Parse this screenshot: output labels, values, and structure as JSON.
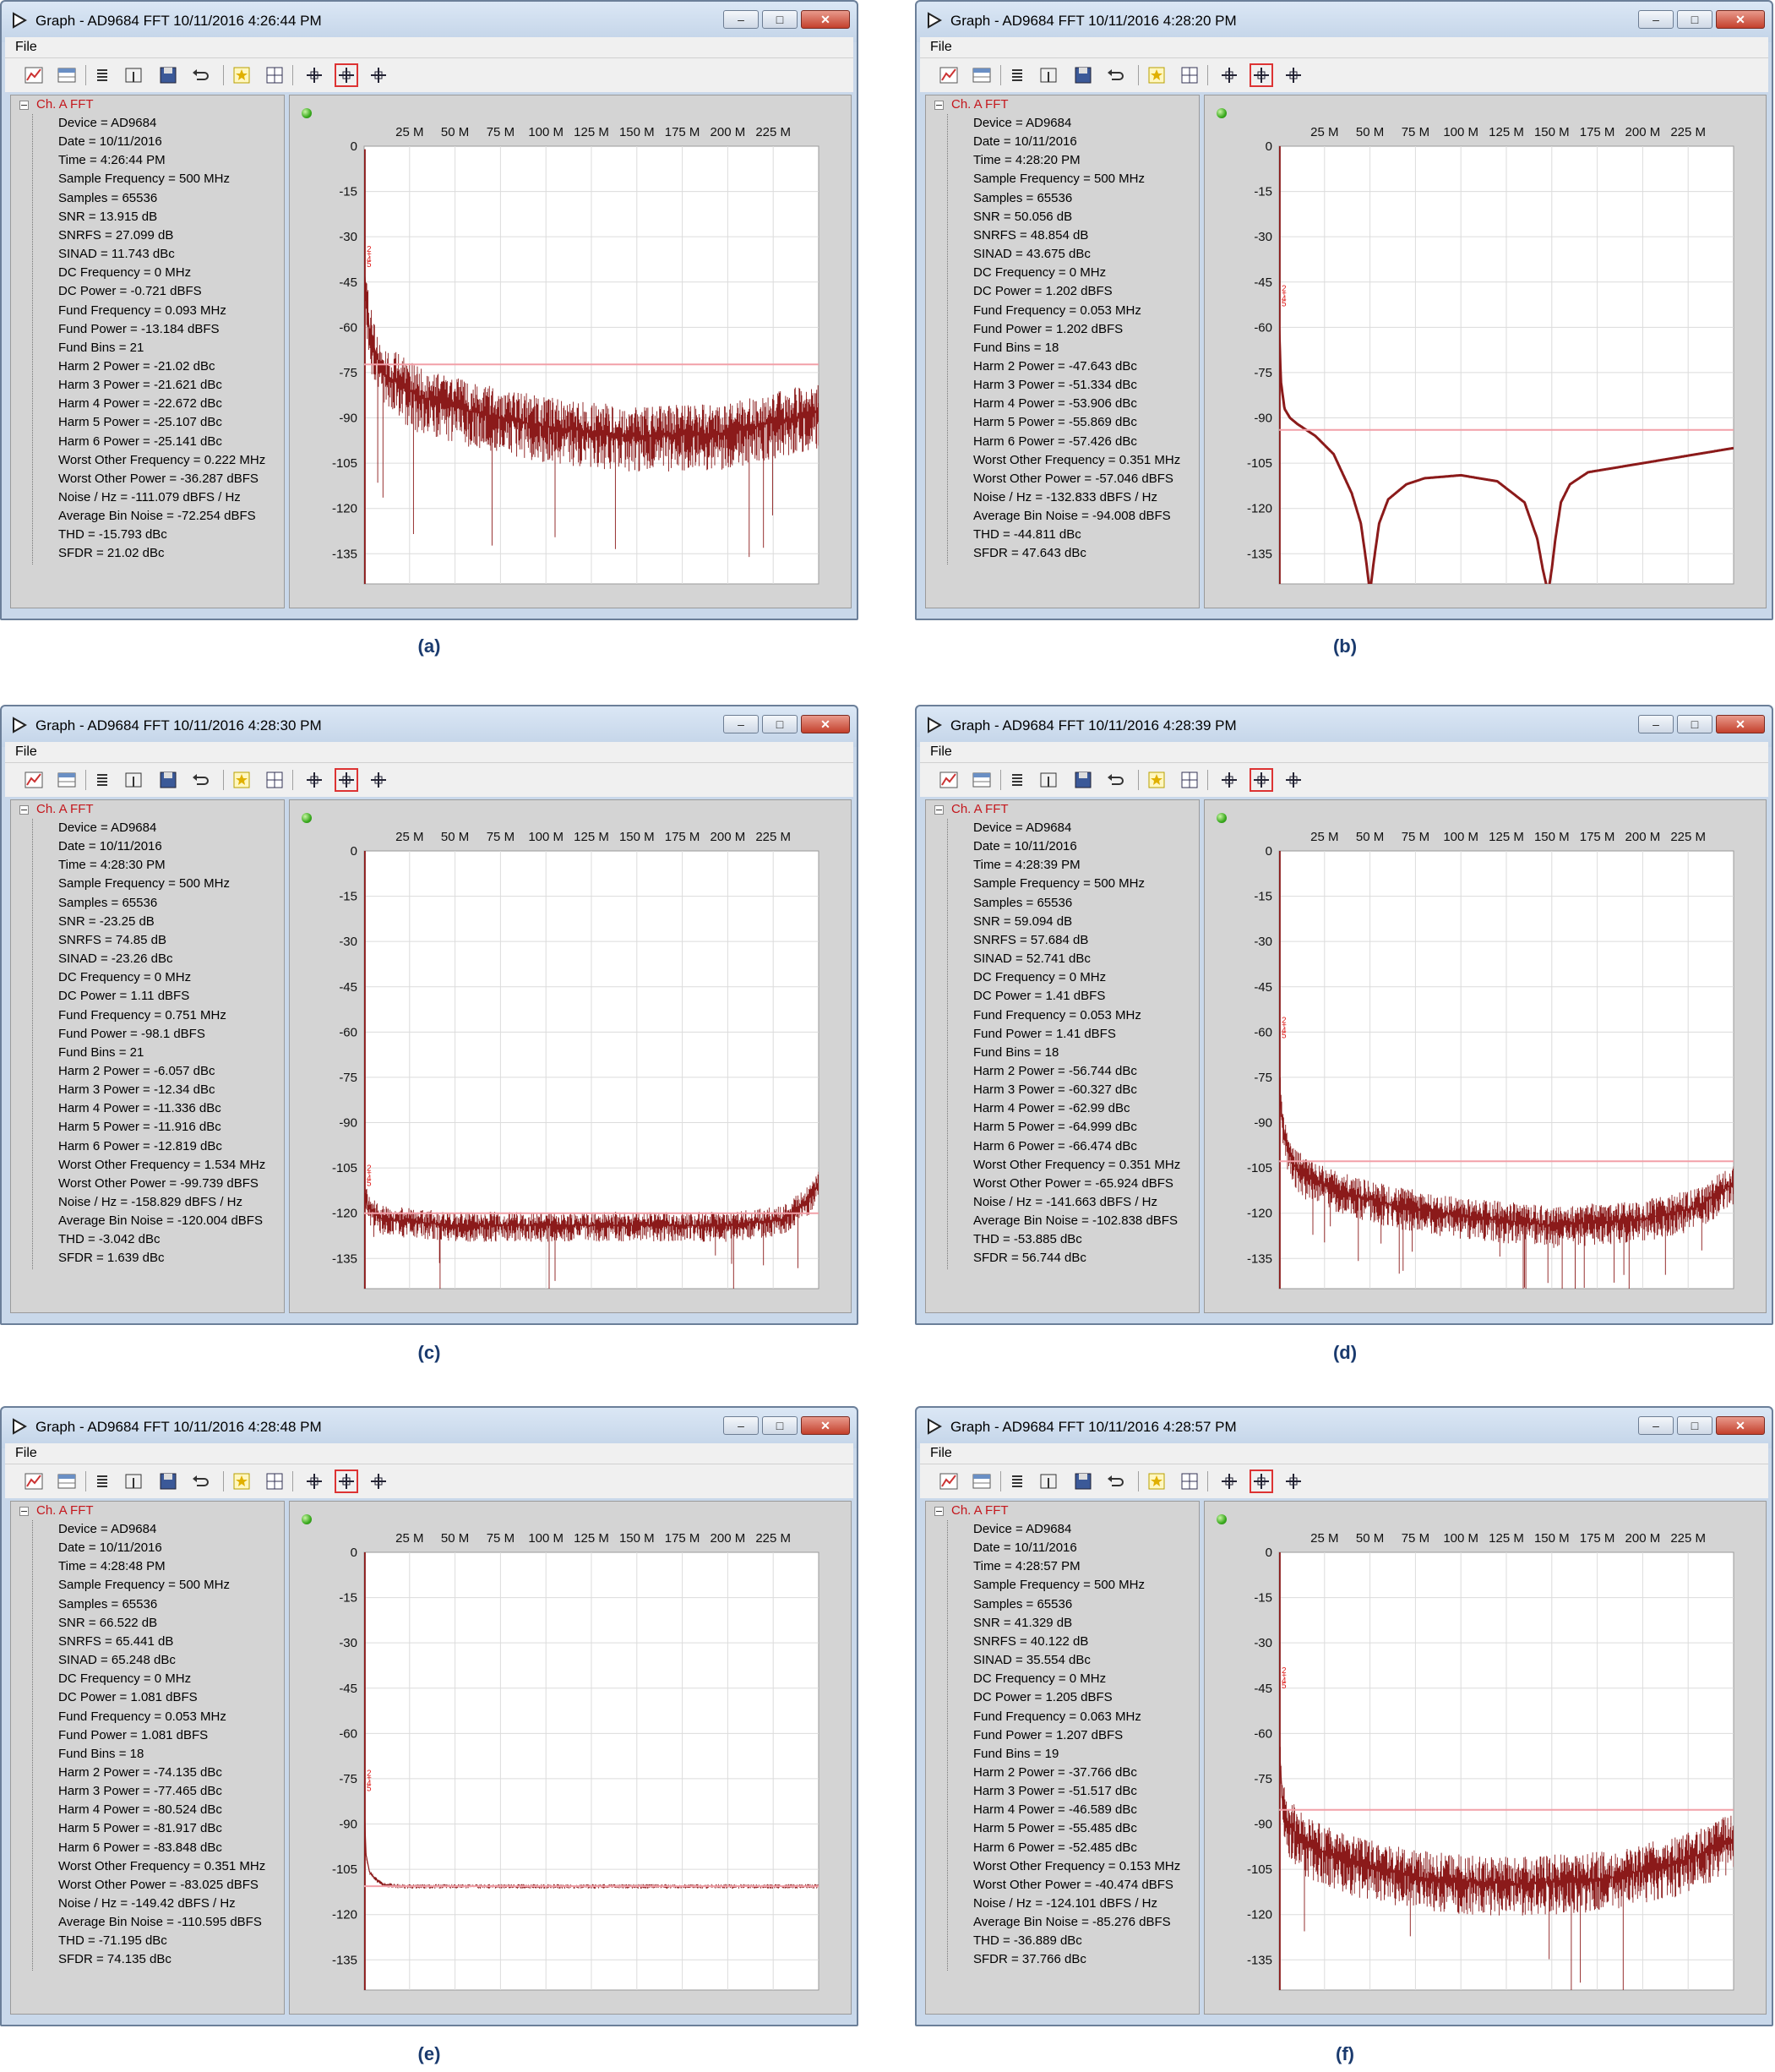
{
  "colors": {
    "trace": "#8b1a1a",
    "noise_line": "#f2a0a8",
    "marker": "#e0201e"
  },
  "icons": [
    "add-graph-icon",
    "table-icon",
    "list-icon",
    "cursor-icon",
    "save-icon",
    "undo-icon",
    "star-icon",
    "grid-icon",
    "zoom-fit-icon",
    "zoom-x-icon",
    "zoom-y-icon"
  ],
  "axes": {
    "x_ticks": [
      "25 M",
      "50 M",
      "75 M",
      "100 M",
      "125 M",
      "150 M",
      "175 M",
      "200 M",
      "225 M"
    ],
    "y_ticks": [
      "0",
      "-15",
      "-30",
      "-45",
      "-60",
      "-75",
      "-90",
      "-105",
      "-120",
      "-135"
    ]
  },
  "windows": [
    {
      "caption": "(a)",
      "title": "Graph - AD9684 FFT 10/11/2016 4:26:44 PM",
      "menu_file": "File",
      "channel": "Ch. A FFT",
      "props": [
        "Device = AD9684",
        "Date = 10/11/2016",
        "Time = 4:26:44 PM",
        "Sample Frequency = 500 MHz",
        "Samples = 65536",
        "SNR = 13.915 dB",
        "SNRFS = 27.099 dB",
        "SINAD = 11.743 dBc",
        "DC Frequency = 0 MHz",
        "DC Power = -0.721 dBFS",
        "Fund Frequency = 0.093 MHz",
        "Fund Power = -13.184 dBFS",
        "Fund Bins = 21",
        "Harm 2 Power = -21.02 dBc",
        "Harm 3 Power = -21.621 dBc",
        "Harm 4 Power = -22.672 dBc",
        "Harm 5 Power = -25.107 dBc",
        "Harm 6 Power = -25.141 dBc",
        "Worst Other Frequency = 0.222 MHz",
        "Worst Other Power = -36.287 dBFS",
        "Noise / Hz = -111.079 dBFS / Hz",
        "Average Bin Noise = -72.254 dBFS",
        "THD = -15.793 dBc",
        "SFDR = 21.02 dBc"
      ],
      "chart_data": {
        "type": "line",
        "x_unit": "MHz",
        "xlim": [
          0,
          250
        ],
        "ylim": [
          -145,
          0
        ],
        "noise_line": -72.3,
        "spike_top": -1,
        "envelope": {
          "x": [
            0,
            3,
            10,
            30,
            60,
            100,
            150,
            200,
            250
          ],
          "y": [
            -40,
            -62,
            -75,
            -83,
            -88,
            -93,
            -96,
            -95,
            -88
          ]
        },
        "spread": 22,
        "spur_depth": "deep",
        "harmonic_markers_y": -35
      }
    },
    {
      "caption": "(b)",
      "title": "Graph - AD9684 FFT 10/11/2016 4:28:20 PM",
      "menu_file": "File",
      "channel": "Ch. A FFT",
      "props": [
        "Device = AD9684",
        "Date = 10/11/2016",
        "Time = 4:28:20 PM",
        "Sample Frequency = 500 MHz",
        "Samples = 65536",
        "SNR = 50.056 dB",
        "SNRFS = 48.854 dB",
        "SINAD = 43.675 dBc",
        "DC Frequency = 0 MHz",
        "DC Power = 1.202 dBFS",
        "Fund Frequency = 0.053 MHz",
        "Fund Power = 1.202 dBFS",
        "Fund Bins = 18",
        "Harm 2 Power = -47.643 dBc",
        "Harm 3 Power = -51.334 dBc",
        "Harm 4 Power = -53.906 dBc",
        "Harm 5 Power = -55.869 dBc",
        "Harm 6 Power = -57.426 dBc",
        "Worst Other Frequency = 0.351 MHz",
        "Worst Other Power = -57.046 dBFS",
        "Noise / Hz = -132.833 dBFS / Hz",
        "Average Bin Noise = -94.008 dBFS",
        "THD = -44.811 dBc",
        "SFDR = 47.643 dBc"
      ],
      "chart_data": {
        "type": "line",
        "x_unit": "MHz",
        "xlim": [
          0,
          250
        ],
        "ylim": [
          -145,
          0
        ],
        "noise_line": -94.0,
        "spike_top": 0,
        "envelope": {
          "x": [
            0,
            1,
            3,
            6,
            10,
            20,
            30,
            40,
            45,
            48,
            50,
            52,
            55,
            60,
            70,
            80,
            100,
            120,
            135,
            142,
            145,
            148,
            150,
            152,
            155,
            160,
            170,
            190,
            210,
            230,
            250
          ],
          "y": [
            -60,
            -78,
            -87,
            -90,
            -92,
            -96,
            -102,
            -115,
            -125,
            -138,
            -148,
            -138,
            -125,
            -117,
            -112,
            -110,
            -109,
            -111,
            -118,
            -130,
            -140,
            -148,
            -140,
            -130,
            -118,
            -112,
            -108,
            -106,
            -104,
            -102,
            -100
          ]
        },
        "spread": 0,
        "spur_depth": "none",
        "harmonic_markers_y": -48
      }
    },
    {
      "caption": "(c)",
      "title": "Graph - AD9684 FFT 10/11/2016 4:28:30 PM",
      "menu_file": "File",
      "channel": "Ch. A FFT",
      "props": [
        "Device = AD9684",
        "Date = 10/11/2016",
        "Time = 4:28:30 PM",
        "Sample Frequency = 500 MHz",
        "Samples = 65536",
        "SNR = -23.25 dB",
        "SNRFS = 74.85 dB",
        "SINAD = -23.26 dBc",
        "DC Frequency = 0 MHz",
        "DC Power = 1.11 dBFS",
        "Fund Frequency = 0.751 MHz",
        "Fund Power = -98.1 dBFS",
        "Fund Bins = 21",
        "Harm 2 Power = -6.057 dBc",
        "Harm 3 Power = -12.34 dBc",
        "Harm 4 Power = -11.336 dBc",
        "Harm 5 Power = -11.916 dBc",
        "Harm 6 Power = -12.819 dBc",
        "Worst Other Frequency = 1.534 MHz",
        "Worst Other Power = -99.739 dBFS",
        "Noise / Hz = -158.829 dBFS / Hz",
        "Average Bin Noise = -120.004 dBFS",
        "THD = -3.042 dBc",
        "SFDR = 1.639 dBc"
      ],
      "chart_data": {
        "type": "line",
        "x_unit": "MHz",
        "xlim": [
          0,
          250
        ],
        "ylim": [
          -145,
          0
        ],
        "noise_line": -120.0,
        "spike_top": 1,
        "envelope": {
          "x": [
            0,
            2,
            10,
            50,
            100,
            150,
            200,
            230,
            245,
            250
          ],
          "y": [
            -112,
            -118,
            -122,
            -124,
            -124,
            -124,
            -124,
            -122,
            -115,
            -110
          ]
        },
        "spread": 10,
        "spur_depth": "medium",
        "harmonic_markers_y": -106
      }
    },
    {
      "caption": "(d)",
      "title": "Graph - AD9684 FFT 10/11/2016 4:28:39 PM",
      "menu_file": "File",
      "channel": "Ch. A FFT",
      "props": [
        "Device = AD9684",
        "Date = 10/11/2016",
        "Time = 4:28:39 PM",
        "Sample Frequency = 500 MHz",
        "Samples = 65536",
        "SNR = 59.094 dB",
        "SNRFS = 57.684 dB",
        "SINAD = 52.741 dBc",
        "DC Frequency = 0 MHz",
        "DC Power = 1.41 dBFS",
        "Fund Frequency = 0.053 MHz",
        "Fund Power = 1.41 dBFS",
        "Fund Bins = 18",
        "Harm 2 Power = -56.744 dBc",
        "Harm 3 Power = -60.327 dBc",
        "Harm 4 Power = -62.99 dBc",
        "Harm 5 Power = -64.999 dBc",
        "Harm 6 Power = -66.474 dBc",
        "Worst Other Frequency = 0.351 MHz",
        "Worst Other Power = -65.924 dBFS",
        "Noise / Hz = -141.663 dBFS / Hz",
        "Average Bin Noise = -102.838 dBFS",
        "THD = -53.885 dBc",
        "SFDR = 56.744 dBc"
      ],
      "chart_data": {
        "type": "line",
        "x_unit": "MHz",
        "xlim": [
          0,
          250
        ],
        "ylim": [
          -145,
          0
        ],
        "noise_line": -102.8,
        "spike_top": 0,
        "envelope": {
          "x": [
            0,
            1,
            3,
            8,
            15,
            30,
            60,
            100,
            150,
            200,
            230,
            250
          ],
          "y": [
            -70,
            -85,
            -95,
            -104,
            -108,
            -112,
            -117,
            -121,
            -124,
            -122,
            -118,
            -110
          ]
        },
        "spread": 14,
        "spur_depth": "medium",
        "harmonic_markers_y": -57
      }
    },
    {
      "caption": "(e)",
      "title": "Graph - AD9684 FFT 10/11/2016 4:28:48 PM",
      "menu_file": "File",
      "channel": "Ch. A FFT",
      "props": [
        "Device = AD9684",
        "Date = 10/11/2016",
        "Time = 4:28:48 PM",
        "Sample Frequency = 500 MHz",
        "Samples = 65536",
        "SNR = 66.522 dB",
        "SNRFS = 65.441 dB",
        "SINAD = 65.248 dBc",
        "DC Frequency = 0 MHz",
        "DC Power = 1.081 dBFS",
        "Fund Frequency = 0.053 MHz",
        "Fund Power = 1.081 dBFS",
        "Fund Bins = 18",
        "Harm 2 Power = -74.135 dBc",
        "Harm 3 Power = -77.465 dBc",
        "Harm 4 Power = -80.524 dBc",
        "Harm 5 Power = -81.917 dBc",
        "Harm 6 Power = -83.848 dBc",
        "Worst Other Frequency = 0.351 MHz",
        "Worst Other Power = -83.025 dBFS",
        "Noise / Hz = -149.42 dBFS / Hz",
        "Average Bin Noise = -110.595 dBFS",
        "THD = -71.195 dBc",
        "SFDR = 74.135 dBc"
      ],
      "chart_data": {
        "type": "line",
        "x_unit": "MHz",
        "xlim": [
          0,
          250
        ],
        "ylim": [
          -145,
          0
        ],
        "noise_line": -110.6,
        "spike_top": 0,
        "envelope": {
          "x": [
            0,
            1,
            3,
            6,
            10,
            20,
            250
          ],
          "y": [
            -80,
            -100,
            -106,
            -108,
            -110,
            -110.6,
            -110.6
          ]
        },
        "spread": 1.5,
        "spur_depth": "low",
        "harmonic_markers_y": -74
      }
    },
    {
      "caption": "(f)",
      "title": "Graph - AD9684 FFT 10/11/2016 4:28:57 PM",
      "menu_file": "File",
      "channel": "Ch. A FFT",
      "props": [
        "Device = AD9684",
        "Date = 10/11/2016",
        "Time = 4:28:57 PM",
        "Sample Frequency = 500 MHz",
        "Samples = 65536",
        "SNR = 41.329 dB",
        "SNRFS = 40.122 dB",
        "SINAD = 35.554 dBc",
        "DC Frequency = 0 MHz",
        "DC Power = 1.205 dBFS",
        "Fund Frequency = 0.063 MHz",
        "Fund Power = 1.207 dBFS",
        "Fund Bins = 19",
        "Harm 2 Power = -37.766 dBc",
        "Harm 3 Power = -51.517 dBc",
        "Harm 4 Power = -46.589 dBc",
        "Harm 5 Power = -55.485 dBc",
        "Harm 6 Power = -52.485 dBc",
        "Worst Other Frequency = 0.153 MHz",
        "Worst Other Power = -40.474 dBFS",
        "Noise / Hz = -124.101 dBFS / Hz",
        "Average Bin Noise = -85.276 dBFS",
        "THD = -36.889 dBc",
        "SFDR = 37.766 dBc"
      ],
      "chart_data": {
        "type": "line",
        "x_unit": "MHz",
        "xlim": [
          0,
          250
        ],
        "ylim": [
          -145,
          0
        ],
        "noise_line": -85.3,
        "spike_top": 0,
        "envelope": {
          "x": [
            0,
            2,
            5,
            15,
            40,
            80,
            130,
            180,
            220,
            250
          ],
          "y": [
            -62,
            -84,
            -90,
            -97,
            -103,
            -108,
            -110,
            -108,
            -103,
            -95
          ]
        },
        "spread": 20,
        "spur_depth": "deep",
        "harmonic_markers_y": -40
      }
    }
  ]
}
